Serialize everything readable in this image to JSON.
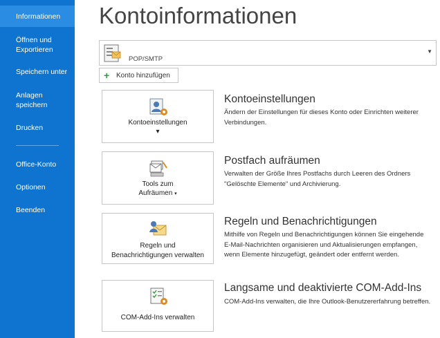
{
  "sidebar": {
    "items": [
      {
        "label": "Informationen"
      },
      {
        "label": "Öffnen und Exportieren"
      },
      {
        "label": "Speichern unter"
      },
      {
        "label": "Anlagen speichern"
      },
      {
        "label": "Drucken"
      },
      {
        "label": "Office-Konto"
      },
      {
        "label": "Optionen"
      },
      {
        "label": "Beenden"
      }
    ]
  },
  "main": {
    "title": "Kontoinformationen",
    "account": {
      "type": "POP/SMTP",
      "icon": "mail-account-icon"
    },
    "add_account_label": "Konto hinzufügen",
    "sections": [
      {
        "button_label_line1": "Kontoeinstellungen",
        "button_caret": "▾",
        "title": "Kontoeinstellungen",
        "description": "Ändern der Einstellungen für dieses Konto oder Einrichten weiterer Verbindungen."
      },
      {
        "button_label_line1": "Tools zum",
        "button_label_line2": "Aufräumen",
        "button_caret": "▾",
        "title": "Postfach aufräumen",
        "description": "Verwalten der Größe Ihres Postfachs durch Leeren des Ordners \"Gelöschte Elemente\" und Archivierung."
      },
      {
        "button_label_line1": "Regeln und",
        "button_label_line2": "Benachrichtigungen verwalten",
        "title": "Regeln und Benachrichtigungen",
        "description": "Mithilfe von Regeln und Benachrichtigungen können Sie eingehende E-Mail-Nachrichten organisieren und Aktualisierungen empfangen, wenn Elemente hinzugefügt, geändert oder entfernt werden."
      },
      {
        "button_label_line1": "COM-Add-Ins verwalten",
        "title": "Langsame und deaktivierte COM-Add-Ins",
        "description": "COM-Add-Ins verwalten, die Ihre Outlook-Benutzererfahrung betreffen."
      }
    ]
  }
}
